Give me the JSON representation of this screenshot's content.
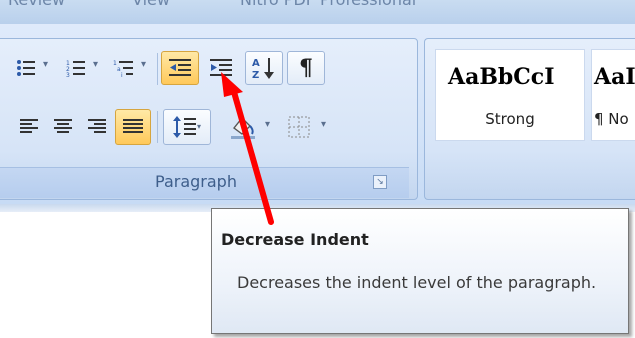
{
  "tabs": [
    {
      "label": "Review"
    },
    {
      "label": "View"
    },
    {
      "label": "Nitro PDF Professional"
    }
  ],
  "paragraph_group": {
    "label": "Paragraph",
    "dialog_launcher_icon": "dialog-launcher-icon",
    "row1": [
      {
        "name": "bullets",
        "icon": "bullets-icon"
      },
      {
        "name": "numbering",
        "icon": "numbering-icon"
      },
      {
        "name": "multilevel-list",
        "icon": "multilevel-list-icon"
      },
      {
        "name": "decrease-indent",
        "icon": "decrease-indent-icon",
        "state": "hover"
      },
      {
        "name": "increase-indent",
        "icon": "increase-indent-icon"
      },
      {
        "name": "sort",
        "icon": "sort-az-icon"
      },
      {
        "name": "show-hide",
        "icon": "pilcrow-icon",
        "glyph": "¶"
      }
    ],
    "row2": [
      {
        "name": "align-left",
        "icon": "align-left-icon"
      },
      {
        "name": "center",
        "icon": "align-center-icon"
      },
      {
        "name": "align-right",
        "icon": "align-right-icon"
      },
      {
        "name": "justify",
        "icon": "justify-icon",
        "state": "selected"
      },
      {
        "name": "line-spacing",
        "icon": "line-spacing-icon"
      },
      {
        "name": "shading",
        "icon": "paint-bucket-icon"
      },
      {
        "name": "borders",
        "icon": "borders-icon"
      }
    ]
  },
  "styles_group": {
    "items": [
      {
        "sample": "AaBbCcI",
        "name": "Strong"
      },
      {
        "sample": "AaI",
        "name": "¶ No"
      }
    ]
  },
  "tooltip": {
    "title": "Decrease Indent",
    "description": "Decreases the indent level of the paragraph."
  },
  "colors": {
    "ribbon_blue": "#d6e4f7",
    "hover_orange": "#ffc95a",
    "annotation_arrow": "#ff0000",
    "group_label_text": "#3e5e8b"
  }
}
